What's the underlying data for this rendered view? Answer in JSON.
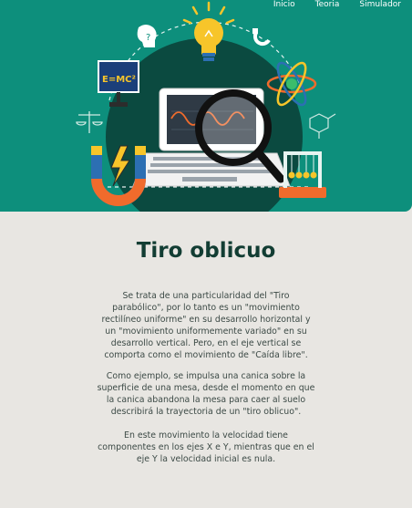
{
  "nav": {
    "items": [
      {
        "label": "Inicio"
      },
      {
        "label": "Teoria"
      },
      {
        "label": "Simulador"
      }
    ]
  },
  "hero": {
    "formula": "E=MC²",
    "icons": [
      "head-idea-icon",
      "lightbulb-icon",
      "magnet-icon",
      "atom-icon",
      "scale-icon",
      "molecule-icon",
      "laptop-graph-icon",
      "magnifier-icon",
      "newton-cradle-icon",
      "lightning-icon"
    ],
    "colors": {
      "background": "#0d8f7c",
      "circle": "#0b4a40",
      "accent_orange": "#f06b2c",
      "accent_yellow": "#f7c52a"
    }
  },
  "content": {
    "title": "Tiro oblicuo",
    "paragraphs": [
      "Se trata de una particularidad del \"Tiro parabólico\", por lo tanto es un \"movimiento rectilíneo uniforme\" en su desarrollo horizontal y un \"movimiento uniformemente variado\" en su desarrollo vertical. Pero, en el eje vertical se comporta como el movimiento de \"Caída libre\".",
      "Como ejemplo, se impulsa una canica sobre la superficie de una mesa, desde el momento en que la canica abandona la mesa para caer al suelo describirá la trayectoria de un \"tiro oblicuo\".",
      "En este movimiento la velocidad tiene componentes en los ejes X e Y, mientras que en el eje Y la velocidad inicial es nula."
    ]
  }
}
